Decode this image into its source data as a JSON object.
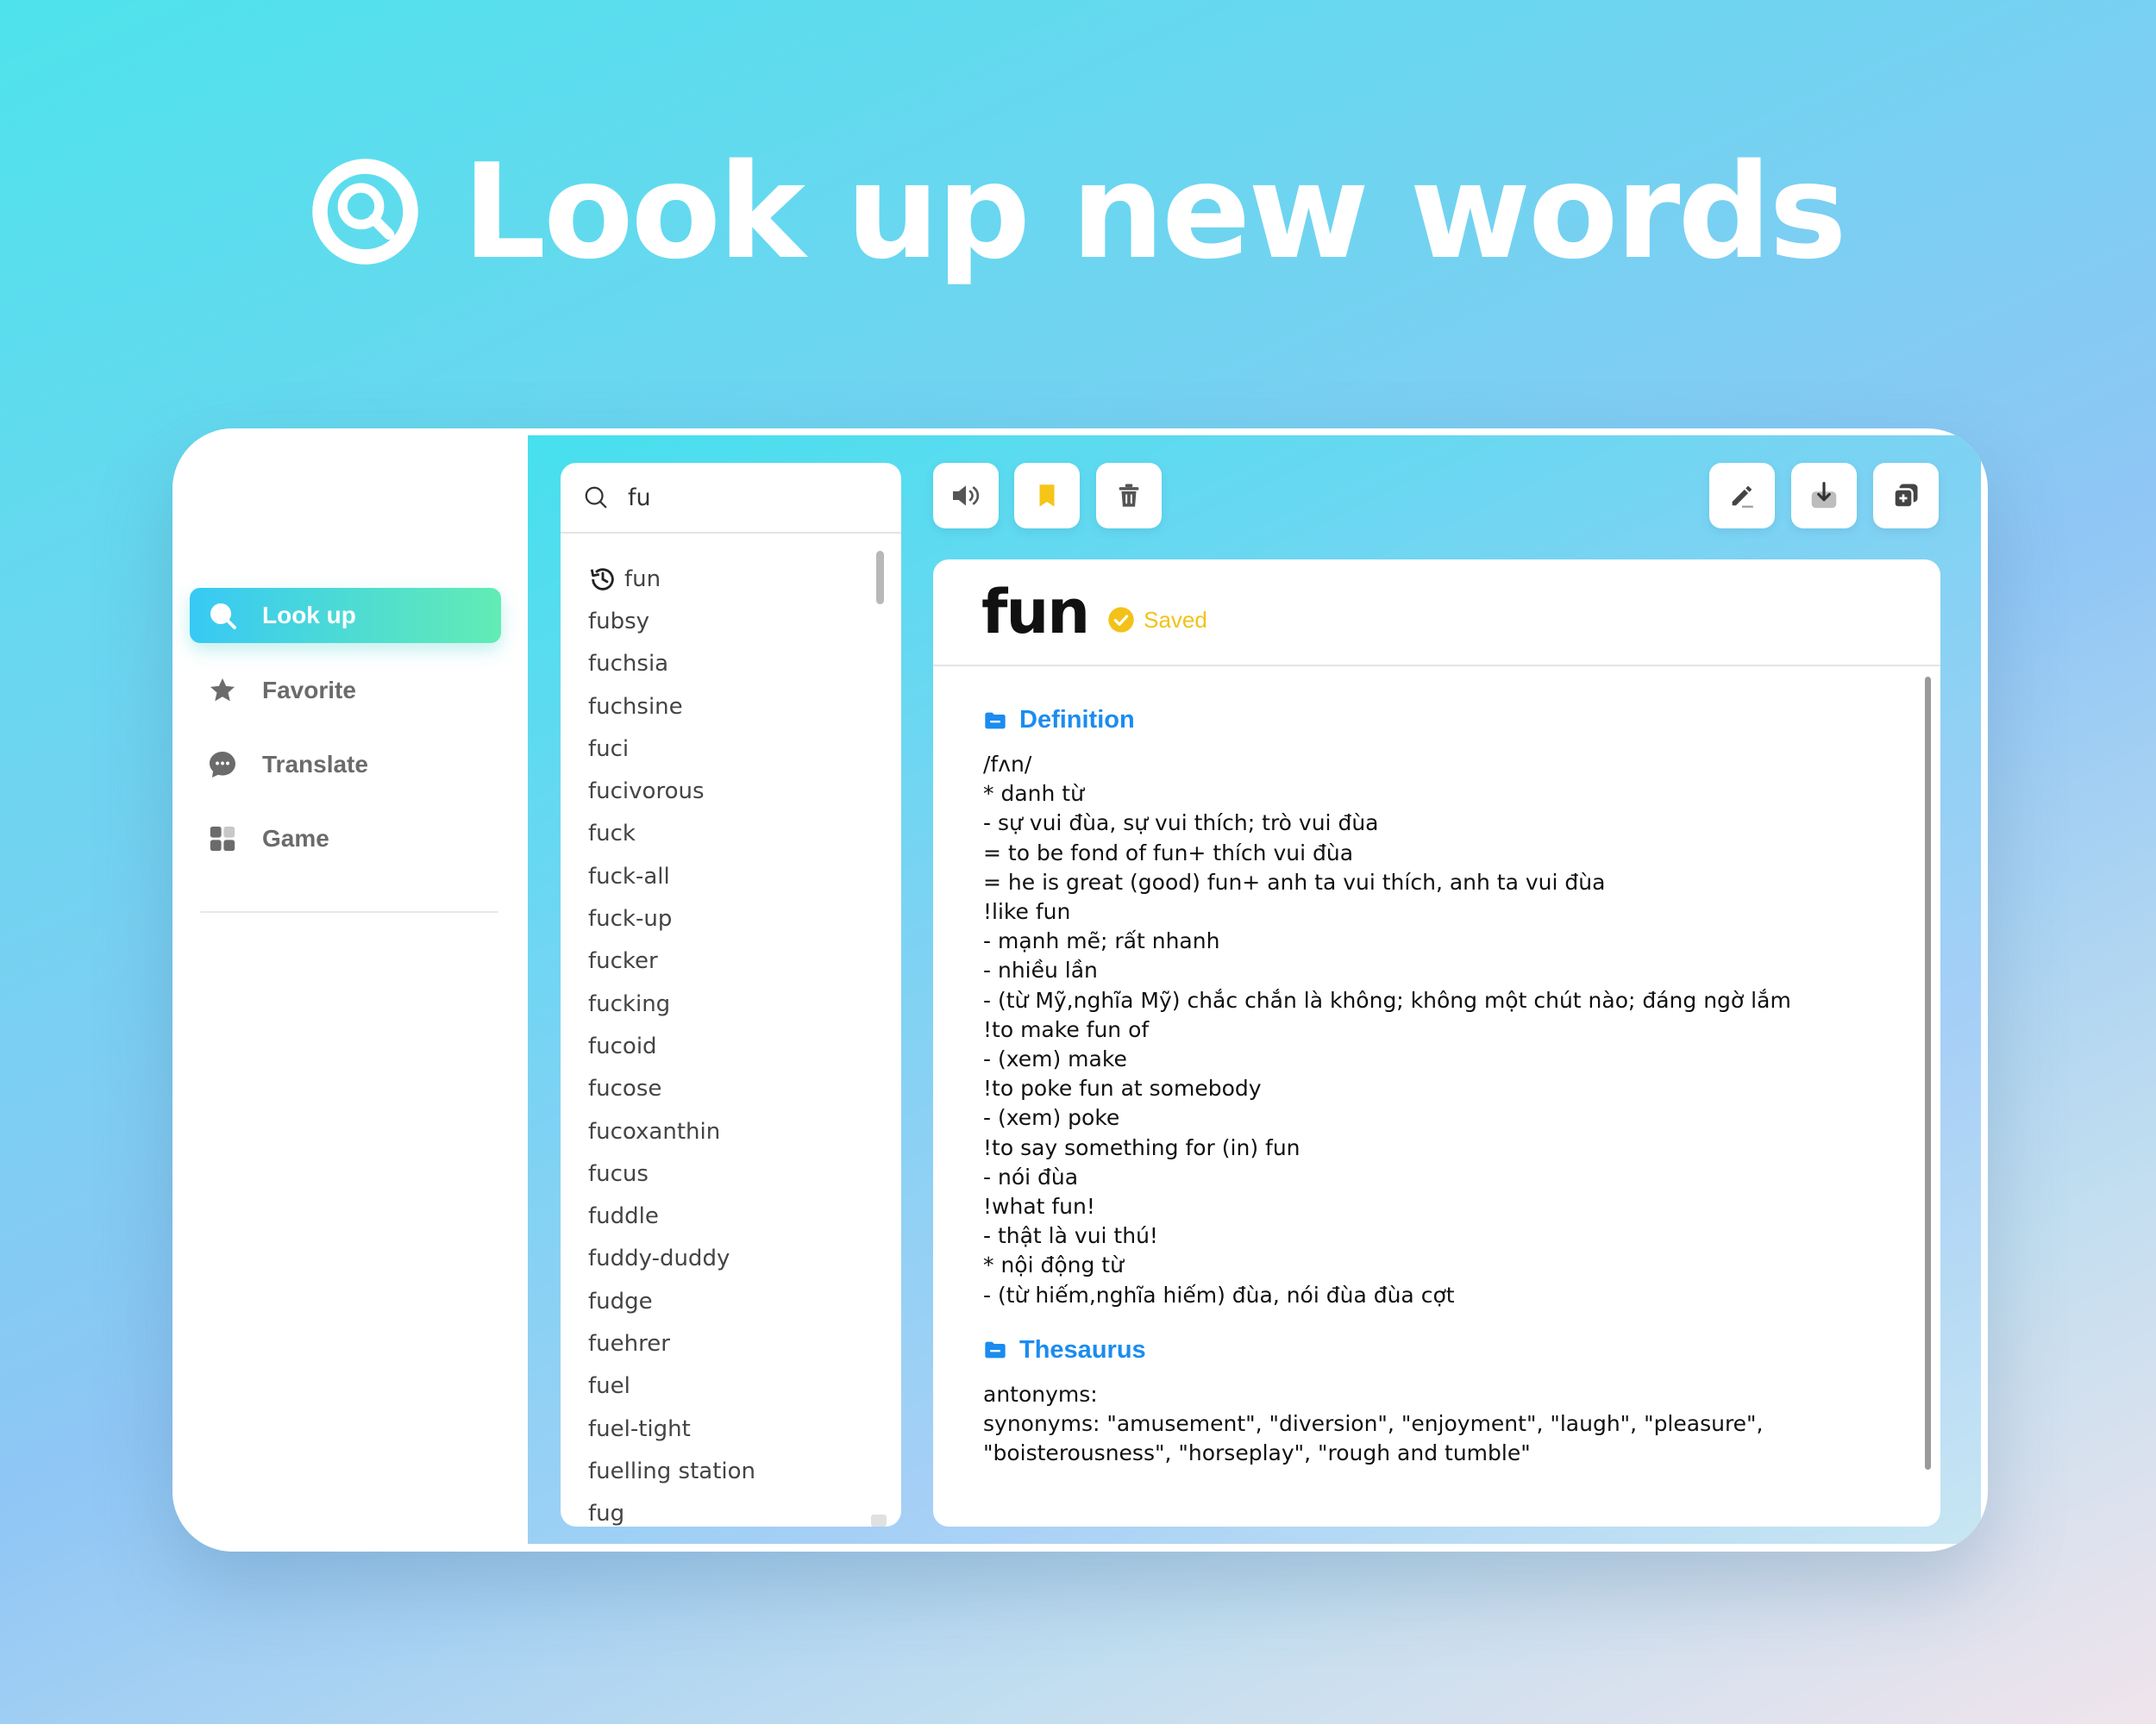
{
  "banner": {
    "title": "Look up new words",
    "icon": "search-icon"
  },
  "sidebar": {
    "items": [
      {
        "label": "Look up",
        "icon": "search-icon",
        "active": true
      },
      {
        "label": "Favorite",
        "icon": "star-icon",
        "active": false
      },
      {
        "label": "Translate",
        "icon": "chat-bubble-icon",
        "active": false
      },
      {
        "label": "Game",
        "icon": "grid-icon",
        "active": false
      }
    ]
  },
  "search": {
    "value": "fu"
  },
  "word_list": {
    "items": [
      "fun",
      "fubsy",
      "fuchsia",
      "fuchsine",
      "fuci",
      "fucivorous",
      "fuck",
      "fuck-all",
      "fuck-up",
      "fucker",
      "fucking",
      "fucoid",
      "fucose",
      "fucoxanthin",
      "fucus",
      "fuddle",
      "fuddy-duddy",
      "fudge",
      "fuehrer",
      "fuel",
      "fuel-tight",
      "fuelling station",
      "fug"
    ],
    "history_icon": "history-icon"
  },
  "toolbar": {
    "left": [
      "speaker-icon",
      "bookmark-icon",
      "trash-icon"
    ],
    "right": [
      "edit-icon",
      "download-icon",
      "add-card-icon"
    ],
    "accent_bookmark": "#f5c518"
  },
  "entry": {
    "word": "fun",
    "saved_label": "Saved",
    "definition_title": "Definition",
    "definition_lines": [
      "/fʌn/",
      "* danh từ",
      "- sự vui đùa, sự vui thích; trò vui đùa",
      "= to be fond of fun+ thích vui đùa",
      "= he is great (good) fun+ anh ta vui thích, anh ta vui đùa",
      "!like fun",
      "- mạnh mẽ; rất nhanh",
      "- nhiều lần",
      "- (từ Mỹ,nghĩa Mỹ) chắc chắn là không; không một chút nào; đáng ngờ lắm",
      "!to make fun of",
      "- (xem) make",
      "!to poke fun at somebody",
      "- (xem) poke",
      "!to say something for (in) fun",
      "- nói đùa",
      "!what fun!",
      "- thật là vui thú!",
      "* nội động từ",
      "- (từ hiếm,nghĩa hiếm) đùa, nói đùa đùa cợt"
    ],
    "thesaurus_title": "Thesaurus",
    "thesaurus_lines": [
      "antonyms:",
      "synonyms: \"amusement\", \"diversion\", \"enjoyment\", \"laugh\", \"pleasure\",",
      "\"boisterousness\", \"horseplay\", \"rough and tumble\""
    ]
  },
  "colors": {
    "accent_blue": "#1b8cf0",
    "saved_yellow": "#f2c218",
    "active_gradient_start": "#37c9f5",
    "active_gradient_end": "#62ecb4"
  }
}
